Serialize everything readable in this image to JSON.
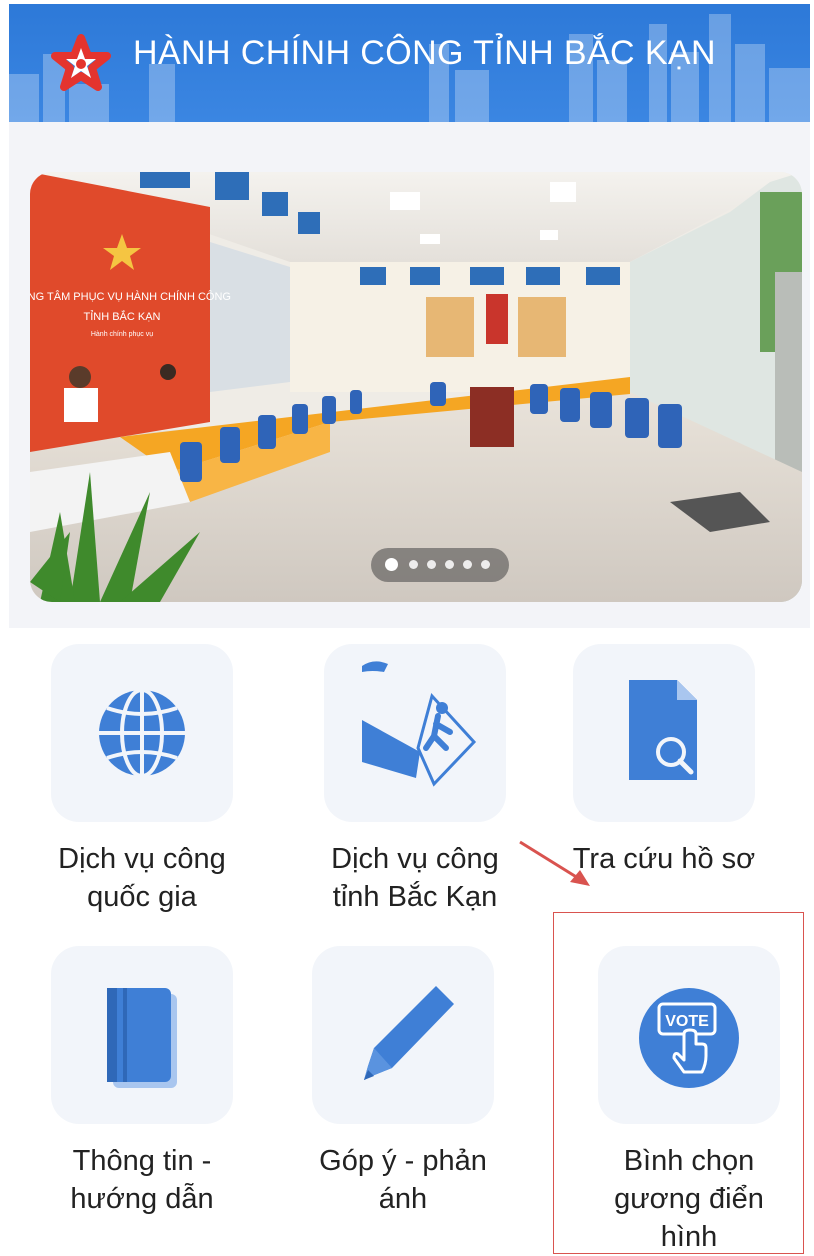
{
  "header": {
    "title": "HÀNH CHÍNH CÔNG TỈNH BẮC KẠN",
    "logo_icon": "star-logo-icon"
  },
  "banner": {
    "sign_line1": "TRUNG TÂM PHỤC VỤ HÀNH CHÍNH CÔNG",
    "sign_line2": "TỈNH BẮC KẠN",
    "sign_line3": "Hành chính phục vụ",
    "slide_count": 6,
    "active_slide": 1
  },
  "menu": {
    "items": [
      {
        "label": "Dịch vụ công\nquốc gia",
        "icon": "globe-icon"
      },
      {
        "label": "Dịch vụ công\ntỉnh Bắc Kạn",
        "icon": "public-service-icon"
      },
      {
        "label": "Tra cứu hồ sơ",
        "icon": "document-search-icon"
      },
      {
        "label": "Thông tin -\nhướng dẫn",
        "icon": "book-icon"
      },
      {
        "label": "Góp ý - phản\nánh",
        "icon": "pencil-icon"
      },
      {
        "label": "Bình chọn\ngương điển\nhình",
        "icon": "vote-icon"
      }
    ],
    "vote_badge": "VOTE"
  },
  "colors": {
    "header_blue": "#2d79d8",
    "icon_blue": "#3f7fd6",
    "annotation_red": "#d9534f"
  }
}
